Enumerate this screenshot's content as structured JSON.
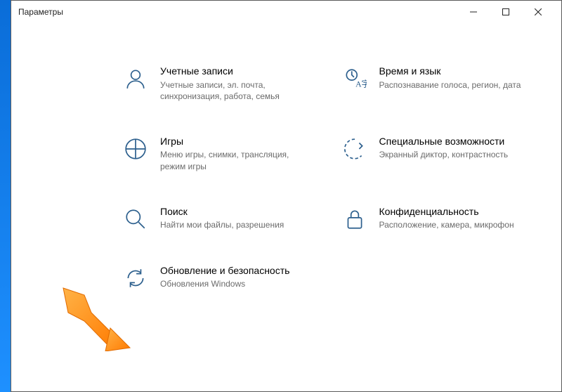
{
  "window": {
    "title": "Параметры"
  },
  "tiles": {
    "accounts": {
      "title": "Учетные записи",
      "desc": "Учетные записи, эл. почта, синхронизация, работа, семья"
    },
    "time": {
      "title": "Время и язык",
      "desc": "Распознавание голоса, регион, дата"
    },
    "gaming": {
      "title": "Игры",
      "desc": "Меню игры, снимки, трансляция, режим игры"
    },
    "accessibility": {
      "title": "Специальные возможности",
      "desc": "Экранный диктор, контрастность"
    },
    "search": {
      "title": "Поиск",
      "desc": "Найти мои файлы, разрешения"
    },
    "privacy": {
      "title": "Конфиденциальность",
      "desc": "Расположение, камера, микрофон"
    },
    "update": {
      "title": "Обновление и безопасность",
      "desc": "Обновления Windows"
    }
  }
}
